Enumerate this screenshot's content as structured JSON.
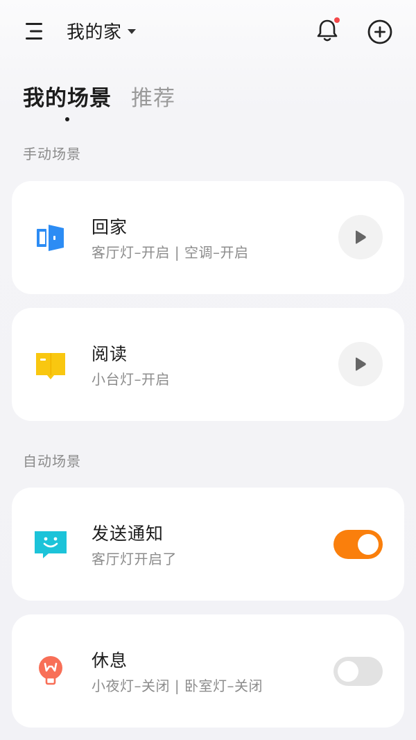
{
  "header": {
    "home_name": "我的家",
    "icons": {
      "menu": "menu-icon",
      "dropdown": "caret-down-icon",
      "notification": "bell-icon",
      "add": "plus-circle-icon"
    },
    "notification_dot_color": "#f4484a"
  },
  "tabs": [
    {
      "label": "我的场景",
      "active": true
    },
    {
      "label": "推荐",
      "active": false
    }
  ],
  "sections": {
    "manual": {
      "label": "手动场景",
      "items": [
        {
          "title": "回家",
          "desc": "客厅灯–开启 | 空调–开启",
          "icon": "door-icon",
          "icon_color": "#2c8cf4",
          "action": "play-icon"
        },
        {
          "title": "阅读",
          "desc": "小台灯–开启",
          "icon": "book-icon",
          "icon_color": "#f9c710",
          "action": "play-icon"
        }
      ]
    },
    "auto": {
      "label": "自动场景",
      "items": [
        {
          "title": "发送通知",
          "desc": "客厅灯开启了",
          "icon": "smiley-message-icon",
          "icon_color": "#1cc3d9",
          "enabled": true
        },
        {
          "title": "休息",
          "desc": "小夜灯–关闭 | 卧室灯–关闭",
          "icon": "lightbulb-icon",
          "icon_color": "#f86f57",
          "enabled": false
        }
      ]
    }
  },
  "colors": {
    "accent_toggle_on": "#fa7f0c",
    "toggle_off": "#e2e2e2"
  }
}
